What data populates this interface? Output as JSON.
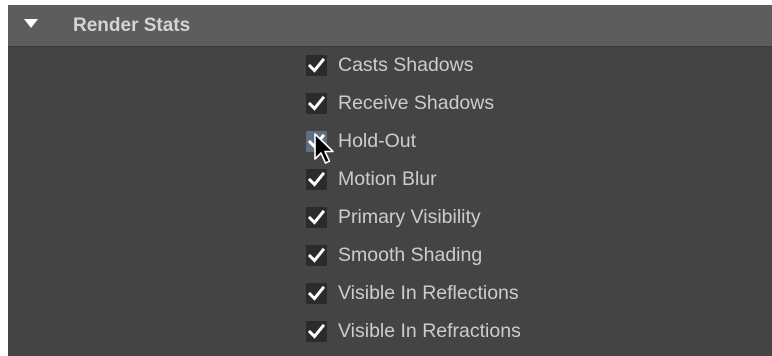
{
  "section": {
    "title": "Render Stats",
    "expanded": true
  },
  "options": [
    {
      "label": "Casts Shadows",
      "checked": true
    },
    {
      "label": "Receive Shadows",
      "checked": true
    },
    {
      "label": "Hold-Out",
      "checked": true
    },
    {
      "label": "Motion Blur",
      "checked": true
    },
    {
      "label": "Primary Visibility",
      "checked": true
    },
    {
      "label": "Smooth Shading",
      "checked": true
    },
    {
      "label": "Visible In Reflections",
      "checked": true
    },
    {
      "label": "Visible In Refractions",
      "checked": true
    }
  ],
  "colors": {
    "panel_bg": "#444444",
    "header_bg": "#5d5d5d",
    "checkbox_bg": "#2b2b2b",
    "checkbox_hover_bg": "#5e7080",
    "label_text": "#cccccc",
    "title_text": "#d4d4d4"
  }
}
